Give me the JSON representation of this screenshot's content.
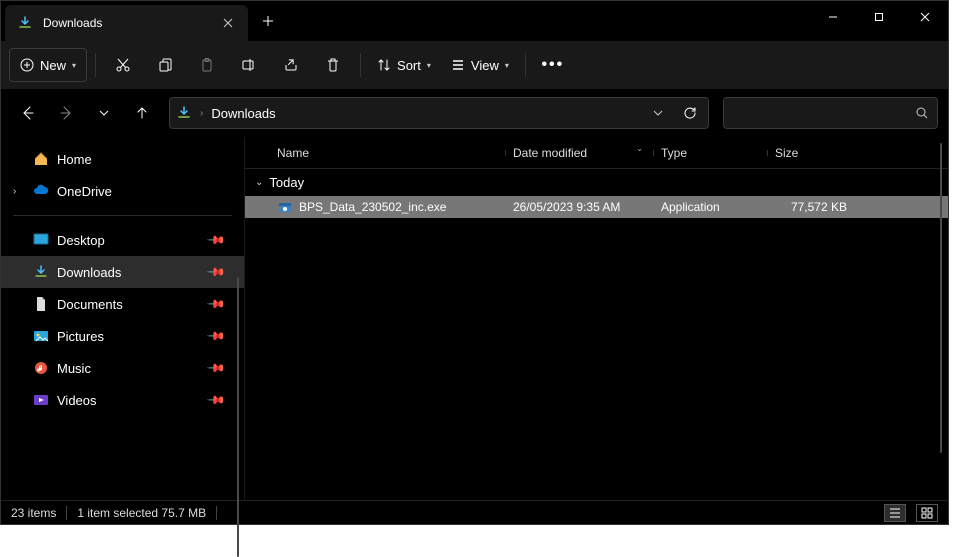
{
  "tab": {
    "title": "Downloads"
  },
  "toolbar": {
    "new_label": "New",
    "sort_label": "Sort",
    "view_label": "View"
  },
  "breadcrumb": {
    "location": "Downloads"
  },
  "sidebar": {
    "top": [
      {
        "label": "Home",
        "icon": "home"
      },
      {
        "label": "OneDrive",
        "icon": "onedrive",
        "expandable": true
      }
    ],
    "quick": [
      {
        "label": "Desktop",
        "icon": "desktop",
        "pinned": true
      },
      {
        "label": "Downloads",
        "icon": "downloads",
        "pinned": true,
        "selected": true
      },
      {
        "label": "Documents",
        "icon": "documents",
        "pinned": true
      },
      {
        "label": "Pictures",
        "icon": "pictures",
        "pinned": true
      },
      {
        "label": "Music",
        "icon": "music",
        "pinned": true
      },
      {
        "label": "Videos",
        "icon": "videos",
        "pinned": true
      }
    ]
  },
  "columns": {
    "name": "Name",
    "date": "Date modified",
    "type": "Type",
    "size": "Size"
  },
  "group": {
    "label": "Today"
  },
  "files": [
    {
      "name": "BPS_Data_230502_inc.exe",
      "date": "26/05/2023 9:35 AM",
      "type": "Application",
      "size": "77,572 KB",
      "selected": true
    }
  ],
  "status": {
    "count": "23 items",
    "selection": "1 item selected  75.7 MB"
  }
}
